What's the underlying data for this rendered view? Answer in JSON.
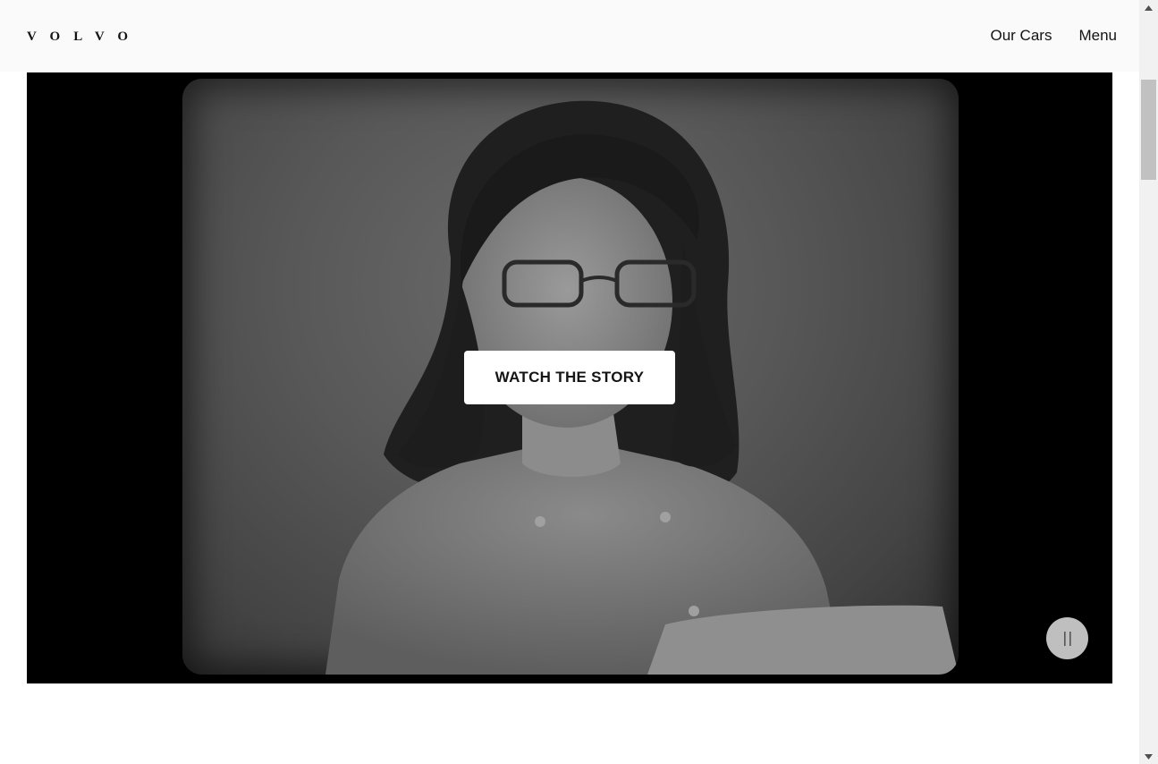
{
  "header": {
    "logo": "VOLVO",
    "nav": {
      "our_cars": "Our Cars",
      "menu": "Menu"
    }
  },
  "video": {
    "cta_label": "WATCH THE STORY",
    "control_icon": "pause-icon",
    "state": "playing"
  },
  "scrollbar": {
    "up_icon": "scroll-up-arrow-icon",
    "down_icon": "scroll-down-arrow-icon"
  },
  "colors": {
    "header_bg": "#fafafa",
    "text": "#141414",
    "video_bg": "#000000",
    "button_bg": "#ffffff"
  }
}
